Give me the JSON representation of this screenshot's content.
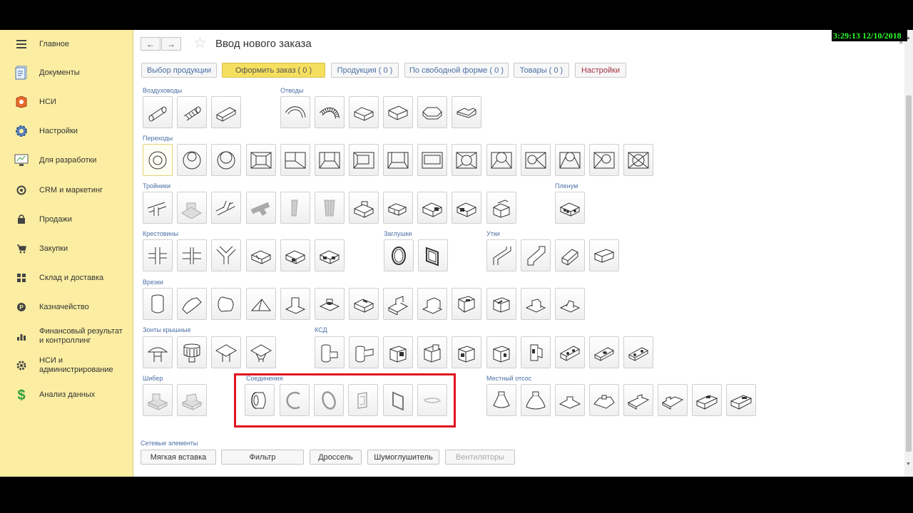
{
  "clock": "3:29:13  12/10/2018",
  "sidebar": {
    "items": [
      {
        "label": "Главное",
        "icon": "menu-icon"
      },
      {
        "label": "Документы",
        "icon": "documents-icon"
      },
      {
        "label": "НСИ",
        "icon": "book-icon"
      },
      {
        "label": "Настройки",
        "icon": "gear-icon"
      },
      {
        "label": "Для разработки",
        "icon": "monitor-icon"
      },
      {
        "label": "CRM и маркетинг",
        "icon": "crm-icon"
      },
      {
        "label": "Продажи",
        "icon": "bag-icon"
      },
      {
        "label": "Закупки",
        "icon": "cart-icon"
      },
      {
        "label": "Склад и доставка",
        "icon": "warehouse-icon"
      },
      {
        "label": "Казначейство",
        "icon": "coin-icon"
      },
      {
        "label": "Финансовый результат и контроллинг",
        "icon": "bar-chart-icon"
      },
      {
        "label": "НСИ и администрирование",
        "icon": "gear-icon"
      },
      {
        "label": "Анализ данных",
        "icon": "dollar-icon"
      }
    ]
  },
  "header": {
    "back": "←",
    "forward": "→",
    "star": "☆",
    "title": "Ввод нового заказа",
    "close": "×"
  },
  "tabs": [
    {
      "label": "Выбор продукции"
    },
    {
      "label": "Оформить заказ ( 0 )"
    },
    {
      "label": "Продукция ( 0 )"
    },
    {
      "label": "По свободной форме ( 0 )"
    },
    {
      "label": "Товары ( 0 )"
    },
    {
      "label": "Настройки"
    }
  ],
  "sections": {
    "vozdukhovody": "Воздуховоды",
    "otvody": "Отводы",
    "perekhody": "Переходы",
    "troyniki": "Тройники",
    "plenum": "Пленум",
    "krestoviny": "Крестовины",
    "zaglushki": "Заглушки",
    "utki": "Утки",
    "vrezki": "Врезки",
    "zonty": "Зонты крышные",
    "ksd": "КСД",
    "shiber": "Шибер",
    "soedineniya": "Соединения",
    "mestny": "Местный отсос",
    "setevye": "Сетевые элементы"
  },
  "bottom_buttons": [
    {
      "label": "Мягкая вставка"
    },
    {
      "label": "Фильтр"
    },
    {
      "label": "Дроссель"
    },
    {
      "label": "Шумоглушитель"
    },
    {
      "label": "Вентиляторы"
    }
  ],
  "colors": {
    "sidebar_bg": "#fbeea2",
    "accent": "#f5df5e",
    "link_blue": "#4a6fa5",
    "highlight_red": "#e01420",
    "clock_green": "#2cff2c"
  }
}
